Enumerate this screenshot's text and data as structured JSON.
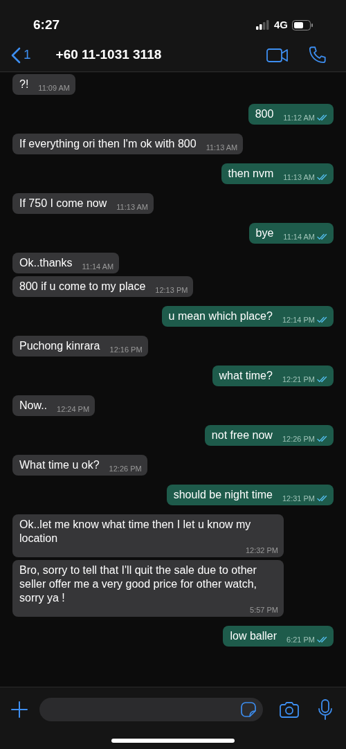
{
  "status_bar": {
    "time": "6:27",
    "network": "4G"
  },
  "header": {
    "back_count": "1",
    "title": "+60 11-1031 3118"
  },
  "messages": [
    {
      "text": "?!",
      "time": "11:09 AM",
      "sent": false
    },
    {
      "text": "800",
      "time": "11:12 AM",
      "sent": true,
      "read": true
    },
    {
      "text": "If everything ori then I'm ok with 800",
      "time": "11:13 AM",
      "sent": false
    },
    {
      "text": "then nvm",
      "time": "11:13 AM",
      "sent": true,
      "read": true
    },
    {
      "text": "If 750 I come now",
      "time": "11:13 AM",
      "sent": false
    },
    {
      "text": "bye",
      "time": "11:14 AM",
      "sent": true,
      "read": true
    },
    {
      "text": "Ok..thanks",
      "time": "11:14 AM",
      "sent": false
    },
    {
      "text": "800 if u come to my place",
      "time": "12:13 PM",
      "sent": false
    },
    {
      "text": "u mean which place?",
      "time": "12:14 PM",
      "sent": true,
      "read": true
    },
    {
      "text": "Puchong kinrara",
      "time": "12:16 PM",
      "sent": false
    },
    {
      "text": "what time?",
      "time": "12:21 PM",
      "sent": true,
      "read": true
    },
    {
      "text": "Now..",
      "time": "12:24 PM",
      "sent": false
    },
    {
      "text": "not free now",
      "time": "12:26 PM",
      "sent": true,
      "read": true
    },
    {
      "text": "What time u ok?",
      "time": "12:26 PM",
      "sent": false
    },
    {
      "text": "should be night time",
      "time": "12:31 PM",
      "sent": true,
      "read": true
    },
    {
      "text": "Ok..let me know what time then I let u know my location",
      "time": "12:32 PM",
      "sent": false
    },
    {
      "text": "Bro, sorry to tell that I'll quit the sale due to other seller offer me a very good price for other watch, sorry ya !",
      "time": "5:57 PM",
      "sent": false
    },
    {
      "text": "low baller",
      "time": "6:21 PM",
      "sent": true,
      "read": true
    }
  ]
}
